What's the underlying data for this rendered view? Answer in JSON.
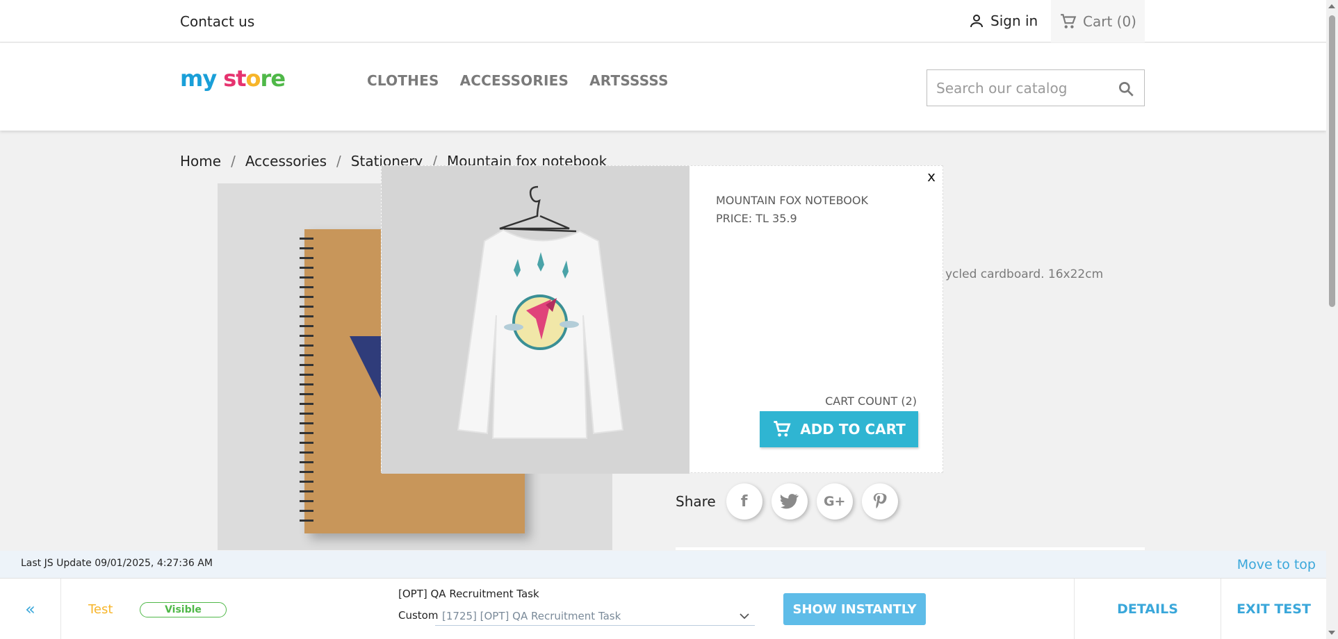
{
  "topbar": {
    "contact": "Contact us",
    "signin": "Sign in",
    "cart": "Cart (0)"
  },
  "header": {
    "logo_parts": [
      "my",
      "st",
      "o",
      "re"
    ],
    "nav": [
      "CLOTHES",
      "ACCESSORIES",
      "ARTSSSSS"
    ],
    "search_placeholder": "Search our catalog"
  },
  "breadcrumb": [
    "Home",
    "Accessories",
    "Stationery",
    "Mountain fox notebook"
  ],
  "product": {
    "description_fragment": "ycled cardboard. 16x22cm",
    "share_label": "Share",
    "share_icons": [
      "facebook-icon",
      "twitter-icon",
      "google-plus-icon",
      "pinterest-icon"
    ]
  },
  "modal": {
    "close": "x",
    "title": "MOUNTAIN FOX NOTEBOOK",
    "price": "PRICE: TL 35.9",
    "cart_count": "CART COUNT (2)",
    "add_to_cart": "ADD TO CART"
  },
  "overlay": {
    "last_update": "Last JS Update 09/01/2025, 4:27:36 AM",
    "move_to_top": "Move to top",
    "collapse": "«",
    "test_label": "Test",
    "visible_badge": "Visible",
    "task_name": "[OPT] QA Recruitment Task",
    "custom_label": "Custom",
    "task_select_value": "[1725] [OPT] QA Recruitment Task",
    "show_instantly": "SHOW INSTANTLY",
    "details": "DETAILS",
    "exit_test": "EXIT TEST"
  },
  "colors": {
    "accent": "#2fb5d2",
    "link_blue": "#3aa7da",
    "test_orange": "#f7b52a",
    "visible_green": "#4fb848"
  }
}
